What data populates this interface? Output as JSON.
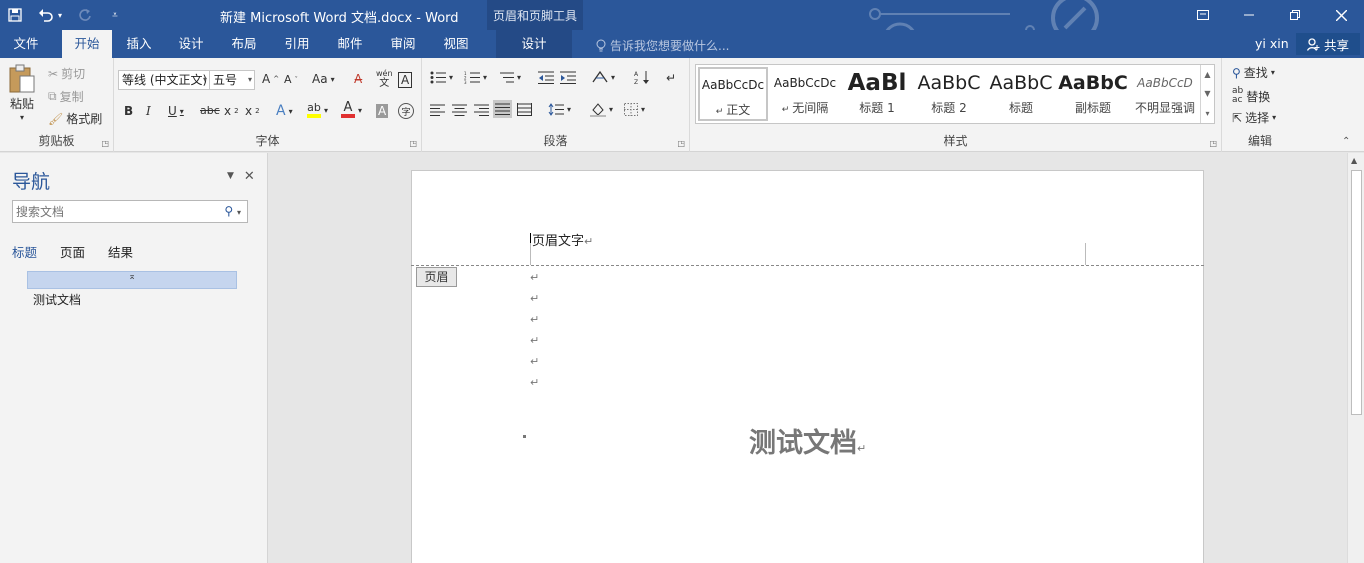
{
  "titlebar": {
    "title": "新建 Microsoft Word 文档.docx - Word",
    "contextual_title": "页眉和页脚工具"
  },
  "tabs": [
    {
      "label": "文件"
    },
    {
      "label": "开始"
    },
    {
      "label": "插入"
    },
    {
      "label": "设计"
    },
    {
      "label": "布局"
    },
    {
      "label": "引用"
    },
    {
      "label": "邮件"
    },
    {
      "label": "审阅"
    },
    {
      "label": "视图"
    },
    {
      "label": "设计"
    }
  ],
  "tellme": "告诉我您想要做什么...",
  "user": "yi xin",
  "share": "共享",
  "clipboard": {
    "paste": "粘贴",
    "cut": "剪切",
    "copy": "复制",
    "format_painter": "格式刷",
    "label": "剪贴板"
  },
  "font": {
    "font_name": "等线 (中文正文)",
    "font_size": "五号",
    "label": "字体"
  },
  "paragraph": {
    "label": "段落"
  },
  "styles": {
    "items": [
      {
        "sample": "AaBbCcDc",
        "name": "正文"
      },
      {
        "sample": "AaBbCcDc",
        "name": "无间隔"
      },
      {
        "sample": "AaBl",
        "name": "标题 1"
      },
      {
        "sample": "AaBbC",
        "name": "标题 2"
      },
      {
        "sample": "AaBbC",
        "name": "标题"
      },
      {
        "sample": "AaBbC",
        "name": "副标题"
      },
      {
        "sample": "AaBbCcD",
        "name": "不明显强调"
      }
    ],
    "label": "样式"
  },
  "editing": {
    "find": "查找",
    "replace": "替换",
    "select": "选择",
    "label": "编辑"
  },
  "nav": {
    "title": "导航",
    "search_placeholder": "搜索文档",
    "tabs": [
      "标题",
      "页面",
      "结果"
    ],
    "heading_item": "测试文档"
  },
  "document": {
    "header_text": "页眉文字",
    "header_tag": "页眉",
    "heading": "测试文档"
  }
}
